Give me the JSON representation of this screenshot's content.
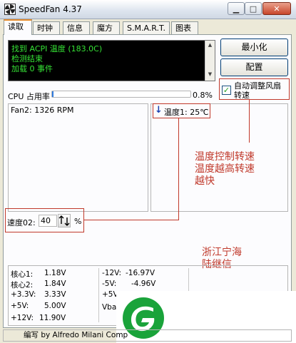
{
  "window": {
    "title": "SpeedFan 4.37",
    "min_glyph": "▁",
    "max_glyph": "□",
    "close_glyph": "✕"
  },
  "tabs": [
    {
      "label": "读取"
    },
    {
      "label": "时钟"
    },
    {
      "label": "信息"
    },
    {
      "label": "魔方"
    },
    {
      "label": "S.M.A.R.T."
    },
    {
      "label": "图表"
    }
  ],
  "log": {
    "lines": [
      "找到 ACPI 温度 (183.0C)",
      "检测结束",
      "加载 0 事件"
    ],
    "text_color": "#35e235"
  },
  "buttons": {
    "minimize": "最小化",
    "configure": "配置"
  },
  "auto_fan": {
    "checked": true,
    "label_line1": "自动调整风扇",
    "label_line2": "转速"
  },
  "cpu_usage": {
    "label": "CPU 占用率",
    "percent_text": "0.8%",
    "value": 0.8
  },
  "fans": [
    {
      "text": "Fan2: 1326 RPM"
    }
  ],
  "temps": [
    {
      "arrow": "↓",
      "text": "温度1: 25℃"
    }
  ],
  "speed": {
    "label": "速度02:",
    "value": "40",
    "unit": "%"
  },
  "annotations": {
    "control": [
      "温度控制转速",
      "温度越高转速",
      "越快"
    ],
    "author": [
      "浙江宁海",
      "陆继信"
    ],
    "color": "#c0392b"
  },
  "voltages": {
    "col1": [
      {
        "label": "核心1:",
        "value": "1.18V"
      },
      {
        "label": "核心2:",
        "value": "1.84V"
      },
      {
        "label": "+3.3V:",
        "value": "3.33V"
      },
      {
        "label": "+5V:",
        "value": "5.00V"
      },
      {
        "label": "+12V:",
        "value": "11.90V"
      }
    ],
    "col2": [
      {
        "label": "-12V:",
        "value": "-16.97V"
      },
      {
        "label": "-5V:",
        "value": "-4.96V"
      },
      {
        "label": "+5V:",
        "value": ""
      },
      {
        "label": "Vbat",
        "value": ""
      }
    ]
  },
  "status_text": "编写 by Alfredo Milani Comp",
  "logo": {
    "name": "green-leaf-logo",
    "color": "#1aa33a"
  }
}
